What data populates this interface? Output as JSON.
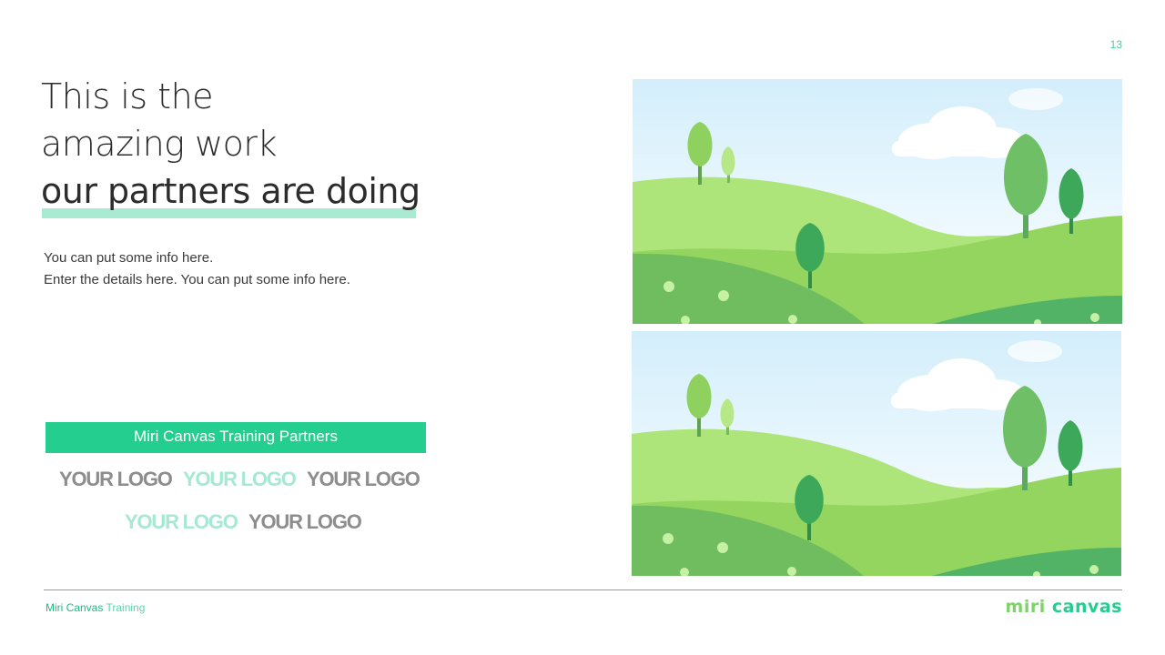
{
  "page": {
    "number": "13"
  },
  "title": {
    "line1": "This is the",
    "line2": "amazing work",
    "line3": "our partners are doing"
  },
  "description": {
    "line1": "You can put some info here.",
    "line2": "Enter the details here. You can put some info here."
  },
  "partners": {
    "banner": "Miri Canvas Training Partners",
    "logos": [
      {
        "label": "YOUR LOGO",
        "color": "#8d8d8d"
      },
      {
        "label": "YOUR LOGO",
        "color": "#a7e8d4"
      },
      {
        "label": "YOUR LOGO",
        "color": "#8d8d8d"
      },
      {
        "label": "YOUR LOGO",
        "color": "#a7e8d4"
      },
      {
        "label": "YOUR LOGO",
        "color": "#8d8d8d"
      }
    ]
  },
  "footer": {
    "brand": "Miri Canvas",
    "sub": "Training",
    "logo_part1": "miri",
    "logo_part2": "canvas"
  },
  "colors": {
    "accent": "#24ce8f",
    "highlight": "#a9ead3",
    "text": "#2c2c2c"
  }
}
